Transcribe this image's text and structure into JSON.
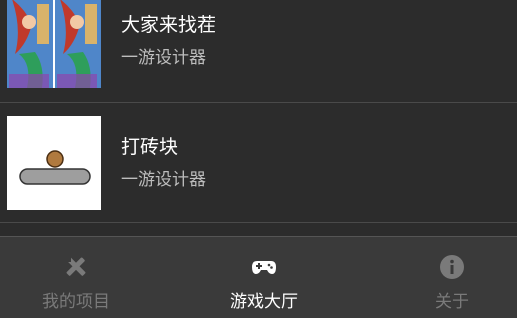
{
  "games": [
    {
      "title": "大家来找茬",
      "subtitle": "一游设计器",
      "thumbnail": "mermaid-spot-difference"
    },
    {
      "title": "打砖块",
      "subtitle": "一游设计器",
      "thumbnail": "ball-and-paddle"
    }
  ],
  "tabbar": {
    "tabs": [
      {
        "label": "我的项目",
        "icon": "design-tools-icon",
        "active": false
      },
      {
        "label": "游戏大厅",
        "icon": "gamepad-icon",
        "active": true
      },
      {
        "label": "关于",
        "icon": "info-icon",
        "active": false
      }
    ]
  },
  "colors": {
    "background": "#2c2c2c",
    "tabbar": "#3a3a3a",
    "active": "#ffffff",
    "inactive": "#7a7a7a"
  }
}
